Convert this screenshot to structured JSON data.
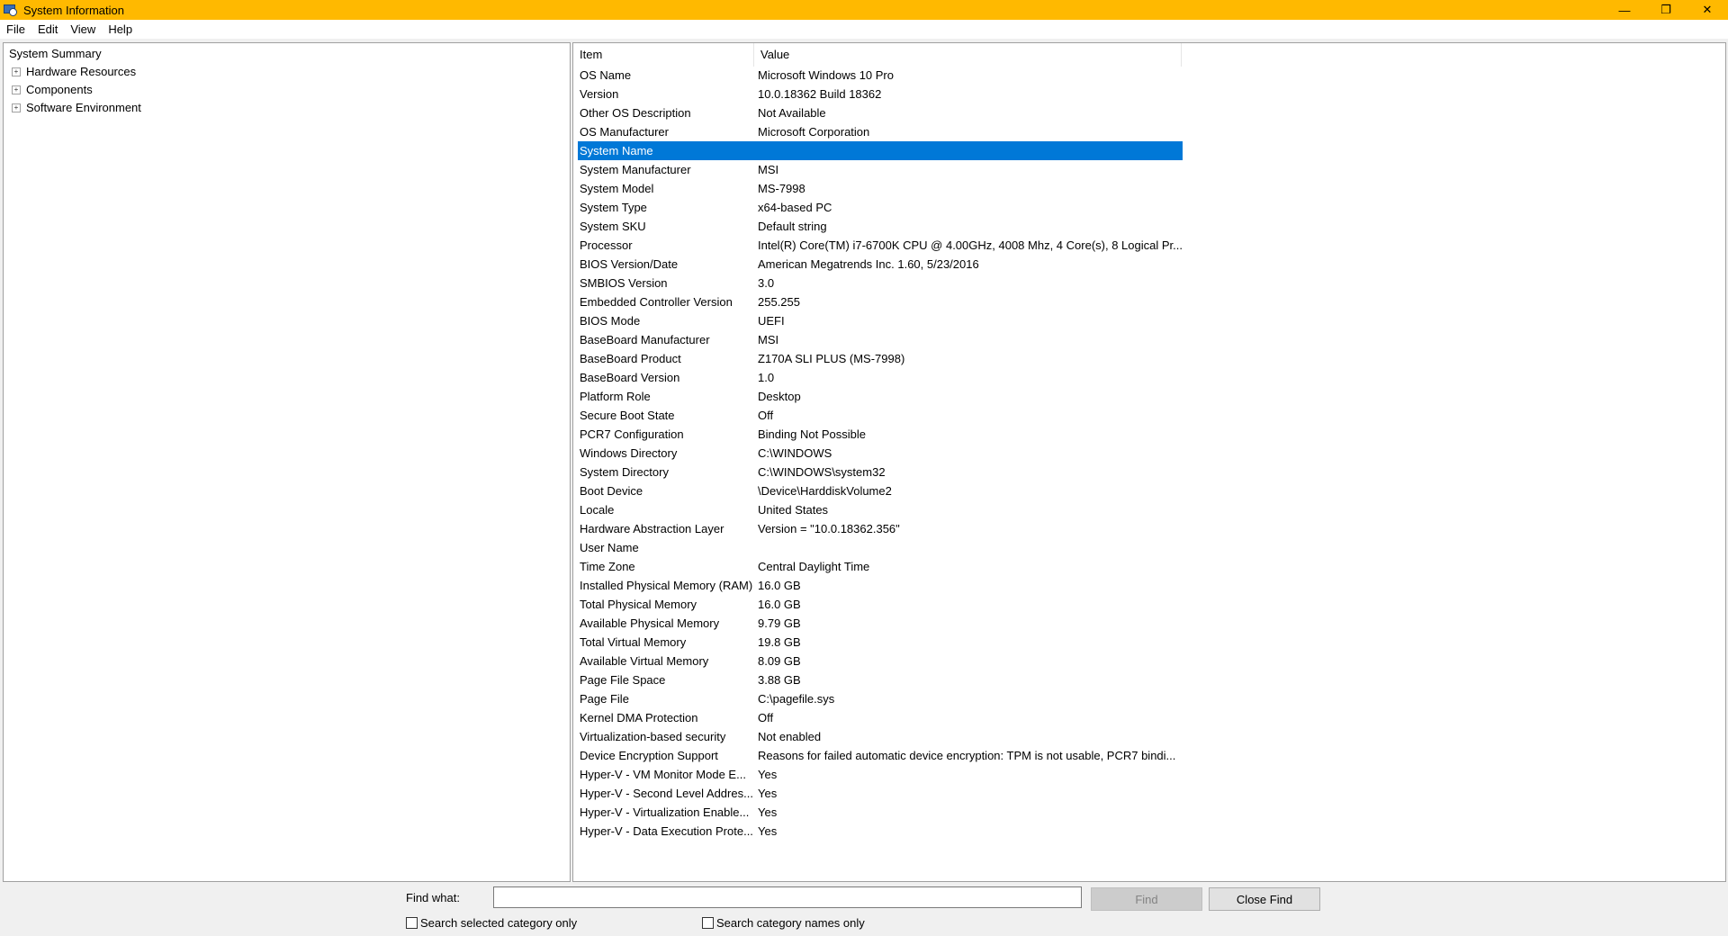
{
  "window": {
    "title": "System Information",
    "controls": {
      "minimize": "—",
      "restore": "❐",
      "close": "✕"
    }
  },
  "menu": [
    "File",
    "Edit",
    "View",
    "Help"
  ],
  "tree": {
    "root": "System Summary",
    "nodes": [
      "Hardware Resources",
      "Components",
      "Software Environment"
    ],
    "expander_symbol": "+"
  },
  "list": {
    "headers": {
      "item": "Item",
      "value": "Value"
    },
    "rows": [
      {
        "item": "OS Name",
        "value": "Microsoft Windows 10 Pro"
      },
      {
        "item": "Version",
        "value": "10.0.18362 Build 18362"
      },
      {
        "item": "Other OS Description",
        "value": "Not Available"
      },
      {
        "item": "OS Manufacturer",
        "value": "Microsoft Corporation"
      },
      {
        "item": "System Name",
        "value": "",
        "selected": true,
        "redacted": true
      },
      {
        "item": "System Manufacturer",
        "value": "MSI"
      },
      {
        "item": "System Model",
        "value": "MS-7998"
      },
      {
        "item": "System Type",
        "value": "x64-based PC"
      },
      {
        "item": "System SKU",
        "value": "Default string"
      },
      {
        "item": "Processor",
        "value": "Intel(R) Core(TM) i7-6700K CPU @ 4.00GHz, 4008 Mhz, 4 Core(s), 8 Logical Pr..."
      },
      {
        "item": "BIOS Version/Date",
        "value": "American Megatrends Inc. 1.60, 5/23/2016"
      },
      {
        "item": "SMBIOS Version",
        "value": "3.0"
      },
      {
        "item": "Embedded Controller Version",
        "value": "255.255"
      },
      {
        "item": "BIOS Mode",
        "value": "UEFI"
      },
      {
        "item": "BaseBoard Manufacturer",
        "value": "MSI"
      },
      {
        "item": "BaseBoard Product",
        "value": "Z170A SLI PLUS (MS-7998)"
      },
      {
        "item": "BaseBoard Version",
        "value": "1.0"
      },
      {
        "item": "Platform Role",
        "value": "Desktop"
      },
      {
        "item": "Secure Boot State",
        "value": "Off"
      },
      {
        "item": "PCR7 Configuration",
        "value": "Binding Not Possible"
      },
      {
        "item": "Windows Directory",
        "value": "C:\\WINDOWS"
      },
      {
        "item": "System Directory",
        "value": "C:\\WINDOWS\\system32"
      },
      {
        "item": "Boot Device",
        "value": "\\Device\\HarddiskVolume2"
      },
      {
        "item": "Locale",
        "value": "United States"
      },
      {
        "item": "Hardware Abstraction Layer",
        "value": "Version = \"10.0.18362.356\""
      },
      {
        "item": "User Name",
        "value": "",
        "redacted": true
      },
      {
        "item": "Time Zone",
        "value": "Central Daylight Time"
      },
      {
        "item": "Installed Physical Memory (RAM)",
        "value": "16.0 GB"
      },
      {
        "item": "Total Physical Memory",
        "value": "16.0 GB"
      },
      {
        "item": "Available Physical Memory",
        "value": "9.79 GB"
      },
      {
        "item": "Total Virtual Memory",
        "value": "19.8 GB"
      },
      {
        "item": "Available Virtual Memory",
        "value": "8.09 GB"
      },
      {
        "item": "Page File Space",
        "value": "3.88 GB"
      },
      {
        "item": "Page File",
        "value": "C:\\pagefile.sys"
      },
      {
        "item": "Kernel DMA Protection",
        "value": "Off"
      },
      {
        "item": "Virtualization-based security",
        "value": "Not enabled"
      },
      {
        "item": "Device Encryption Support",
        "value": "Reasons for failed automatic device encryption: TPM is not usable, PCR7 bindi..."
      },
      {
        "item": "Hyper-V - VM Monitor Mode E...",
        "value": "Yes"
      },
      {
        "item": "Hyper-V - Second Level Addres...",
        "value": "Yes"
      },
      {
        "item": "Hyper-V - Virtualization Enable...",
        "value": "Yes"
      },
      {
        "item": "Hyper-V - Data Execution Prote...",
        "value": "Yes"
      }
    ]
  },
  "find": {
    "label": "Find what:",
    "input_value": "",
    "find_button": "Find",
    "close_button": "Close Find",
    "check_selected": "Search selected category only",
    "check_names": "Search category names only"
  },
  "colors": {
    "titlebar": "#ffb900",
    "selection": "#0078d7"
  }
}
